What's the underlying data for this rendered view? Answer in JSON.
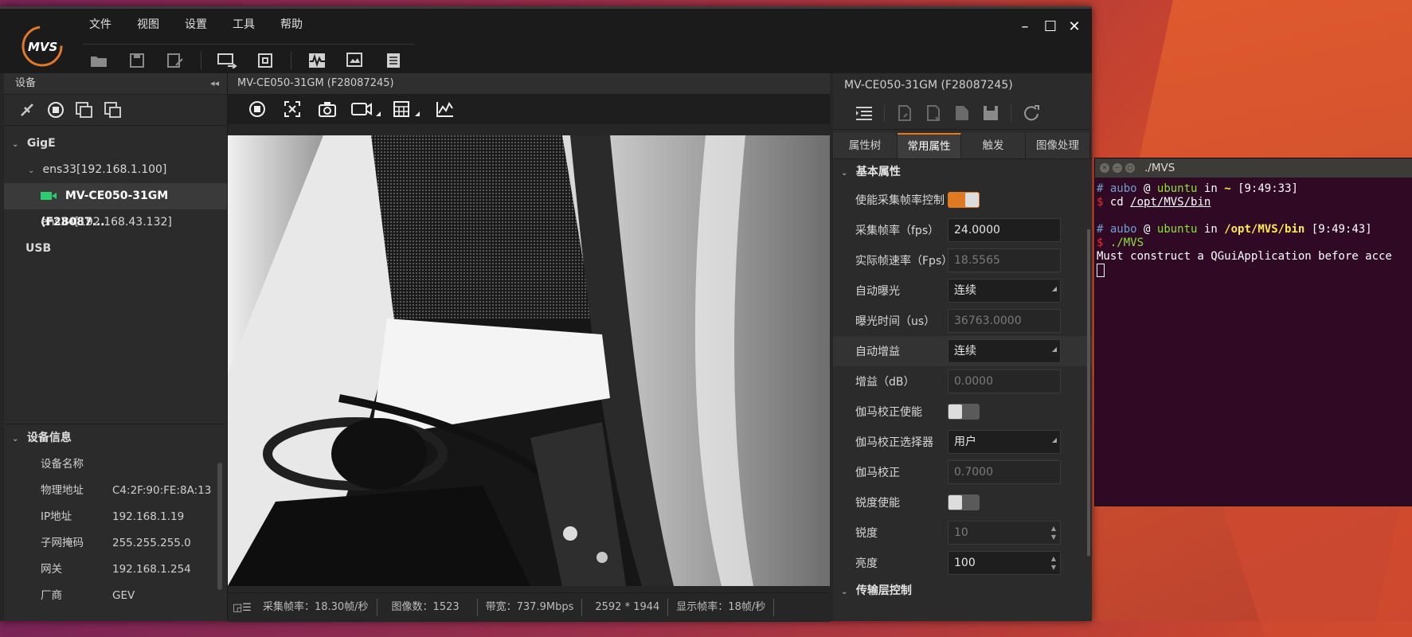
{
  "menu": [
    "文件",
    "视图",
    "设置",
    "工具",
    "帮助"
  ],
  "left": {
    "header": "设备",
    "tree": {
      "gige": "GigE",
      "iface1": "ens33[192.168.1.100]",
      "camera": "MV-CE050-31GM (F28087...",
      "iface2": "ens34[192.168.43.132]",
      "usb": "USB"
    },
    "info_title": "设备信息",
    "info": [
      {
        "k": "设备名称",
        "v": ""
      },
      {
        "k": "物理地址",
        "v": "C4:2F:90:FE:8A:13"
      },
      {
        "k": "IP地址",
        "v": "192.168.1.19"
      },
      {
        "k": "子网掩码",
        "v": "255.255.255.0"
      },
      {
        "k": "网关",
        "v": "192.168.1.254"
      },
      {
        "k": "厂商",
        "v": "GEV"
      }
    ]
  },
  "view": {
    "header": "MV-CE050-31GM (F28087245)",
    "status": {
      "fps": "采集帧率：18.30帧/秒",
      "count": "图像数：1523",
      "bandwidth": "带宽：737.9Mbps",
      "resolution": "2592 * 1944",
      "display_fps": "显示帧率：18帧/秒"
    }
  },
  "props": {
    "header": "MV-CE050-31GM (F28087245)",
    "tabs": [
      "属性树",
      "常用属性",
      "触发",
      "图像处理"
    ],
    "section_basic": "基本属性",
    "section_transport": "传输层控制",
    "rows": {
      "frame_rate_enable": "使能采集帧率控制",
      "frame_rate_label": "采集帧率（fps）",
      "frame_rate_val": "24.0000",
      "actual_fps_label": "实际帧速率（Fps）",
      "actual_fps_val": "18.5565",
      "auto_exposure_label": "自动曝光",
      "auto_exposure_val": "连续",
      "exposure_label": "曝光时间（us）",
      "exposure_val": "36763.0000",
      "auto_gain_label": "自动增益",
      "auto_gain_val": "连续",
      "gain_label": "增益（dB）",
      "gain_val": "0.0000",
      "gamma_enable_label": "伽马校正使能",
      "gamma_selector_label": "伽马校正选择器",
      "gamma_selector_val": "用户",
      "gamma_label": "伽马校正",
      "gamma_val": "0.7000",
      "sharpness_enable_label": "锐度使能",
      "sharpness_label": "锐度",
      "sharpness_val": "10",
      "brightness_label": "亮度",
      "brightness_val": "100"
    }
  },
  "terminal": {
    "title": "./MVS",
    "user": "aubo",
    "host": "ubuntu",
    "line1_dir": "~",
    "line1_time": "[9:49:33]",
    "cmd1": "cd",
    "cmd1_arg": "/opt/MVS/bin",
    "line2_dir": "/opt/MVS/bin",
    "line2_time": "[9:49:43]",
    "cmd2": "./MVS",
    "output": "Must construct a QGuiApplication before acce"
  },
  "colors": {
    "accent": "#e07a22",
    "terminal_bg": "#300a24"
  }
}
